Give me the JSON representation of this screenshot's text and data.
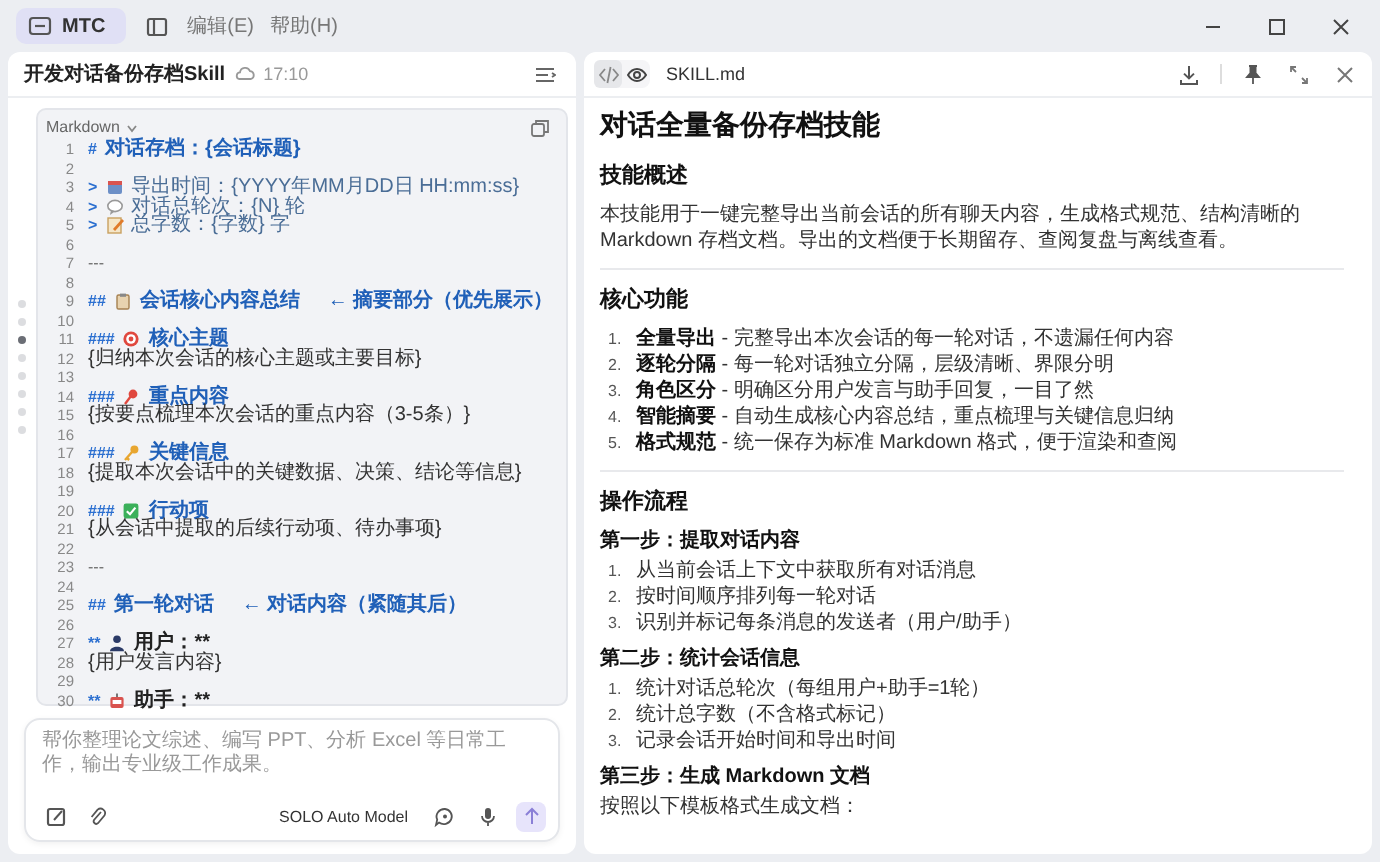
{
  "app_bar": {
    "tabs": [
      {
        "label": "MTC",
        "selected": true
      }
    ],
    "menus": [
      "编辑(E)",
      "帮助(H)"
    ]
  },
  "chat": {
    "title": "开发对话备份存档Skill",
    "time": "17:10",
    "nav_dots": [
      {
        "selected": false
      },
      {
        "selected": false
      },
      {
        "selected": true
      },
      {
        "selected": false
      },
      {
        "selected": false
      },
      {
        "selected": false
      },
      {
        "selected": false
      },
      {
        "selected": false
      }
    ],
    "code_block": {
      "language": "Markdown",
      "lines": [
        {
          "number": "1",
          "kind": "h1",
          "prefix": "#",
          "text": "对话存档：{会话标题}"
        },
        {
          "number": "2",
          "kind": "blank"
        },
        {
          "number": "3",
          "kind": "quote",
          "prefix": ">",
          "text": "导出时间：{YYYY年MM月DD日 HH:mm:ss}"
        },
        {
          "number": "4",
          "kind": "quote",
          "prefix": ">",
          "text": "对话总轮次：{N} 轮"
        },
        {
          "number": "5",
          "kind": "quote",
          "prefix": ">",
          "text": "总字数：{字数} 字"
        },
        {
          "number": "6",
          "kind": "blank"
        },
        {
          "number": "7",
          "kind": "rule",
          "text": "---"
        },
        {
          "number": "8",
          "kind": "blank"
        },
        {
          "number": "9",
          "kind": "h2",
          "prefix": "##",
          "text": "会话核心内容总结",
          "note": "← 摘要部分（优先展示）"
        },
        {
          "number": "10",
          "kind": "blank"
        },
        {
          "number": "11",
          "kind": "h3",
          "prefix": "###",
          "text": "核心主题"
        },
        {
          "number": "12",
          "kind": "plain",
          "text": "{归纳本次会话的核心主题或主要目标}"
        },
        {
          "number": "13",
          "kind": "blank"
        },
        {
          "number": "14",
          "kind": "h3",
          "prefix": "###",
          "text": "重点内容"
        },
        {
          "number": "15",
          "kind": "plain",
          "text": "{按要点梳理本次会话的重点内容（3-5条）}"
        },
        {
          "number": "16",
          "kind": "blank"
        },
        {
          "number": "17",
          "kind": "h3",
          "prefix": "###",
          "text": "关键信息"
        },
        {
          "number": "18",
          "kind": "plain",
          "text": "{提取本次会话中的关键数据、决策、结论等信息}"
        },
        {
          "number": "19",
          "kind": "blank"
        },
        {
          "number": "20",
          "kind": "h3",
          "prefix": "###",
          "text": "行动项"
        },
        {
          "number": "21",
          "kind": "plain",
          "text": "{从会话中提取的后续行动项、待办事项}"
        },
        {
          "number": "22",
          "kind": "blank"
        },
        {
          "number": "23",
          "kind": "rule",
          "text": "---"
        },
        {
          "number": "24",
          "kind": "blank"
        },
        {
          "number": "25",
          "kind": "h2",
          "prefix": "##",
          "text": "第一轮对话",
          "note": "← 对话内容（紧随其后）"
        },
        {
          "number": "26",
          "kind": "blank"
        },
        {
          "number": "27",
          "kind": "bold",
          "prefix": "**",
          "text": "用户：**"
        },
        {
          "number": "28",
          "kind": "plain",
          "text": "{用户发言内容}"
        },
        {
          "number": "29",
          "kind": "blank"
        },
        {
          "number": "30",
          "kind": "bold",
          "prefix": "**",
          "text": "助手：**"
        }
      ]
    },
    "composer": {
      "placeholder": "帮你整理论文综述、编写 PPT、分析 Excel 等日常工作，输出专业级工作成果。",
      "model": "SOLO Auto Model"
    }
  },
  "preview": {
    "modes": [
      {
        "kind": "code",
        "selected": true
      },
      {
        "kind": "eye",
        "selected": false
      }
    ],
    "file_name": "SKILL.md",
    "blocks": [
      {
        "kind": "h1",
        "text": "对话全量备份存档技能"
      },
      {
        "kind": "h2",
        "text": "技能概述"
      },
      {
        "kind": "p",
        "text": "本技能用于一键完整导出当前会话的所有聊天内容，生成格式规范、结构清晰的 Markdown 存档文档。导出的文档便于长期留存、查阅复盘与离线查看。"
      },
      {
        "kind": "rule"
      },
      {
        "kind": "h2",
        "text": "核心功能"
      },
      {
        "kind": "ol",
        "items": [
          {
            "number": "1.",
            "text": "**全量导出** - 完整导出本次会话的每一轮对话，不遗漏任何内容"
          },
          {
            "number": "2.",
            "text": "**逐轮分隔** - 每一轮对话独立分隔，层级清晰、界限分明"
          },
          {
            "number": "3.",
            "text": "**角色区分** - 明确区分用户发言与助手回复，一目了然"
          },
          {
            "number": "4.",
            "text": "**智能摘要** - 自动生成核心内容总结，重点梳理与关键信息归纳"
          },
          {
            "number": "5.",
            "text": "**格式规范** - 统一保存为标准 Markdown 格式，便于渲染和查阅"
          }
        ]
      },
      {
        "kind": "rule"
      },
      {
        "kind": "h2",
        "text": "操作流程"
      },
      {
        "kind": "h3",
        "text": "第一步：提取对话内容"
      },
      {
        "kind": "ol",
        "items": [
          {
            "number": "1.",
            "text": "从当前会话上下文中获取所有对话消息"
          },
          {
            "number": "2.",
            "text": "按时间顺序排列每一轮对话"
          },
          {
            "number": "3.",
            "text": "识别并标记每条消息的发送者（用户/助手）"
          }
        ]
      },
      {
        "kind": "h3",
        "text": "第二步：统计会话信息"
      },
      {
        "kind": "ol",
        "items": [
          {
            "number": "1.",
            "text": "统计对话总轮次（每组用户+助手=1轮）"
          },
          {
            "number": "2.",
            "text": "统计总字数（不含格式标记）"
          },
          {
            "number": "3.",
            "text": "记录会话开始时间和导出时间"
          }
        ]
      },
      {
        "kind": "h3",
        "text": "第三步：生成 Markdown 文档"
      },
      {
        "kind": "p",
        "text": "按照以下模板格式生成文档："
      }
    ]
  }
}
